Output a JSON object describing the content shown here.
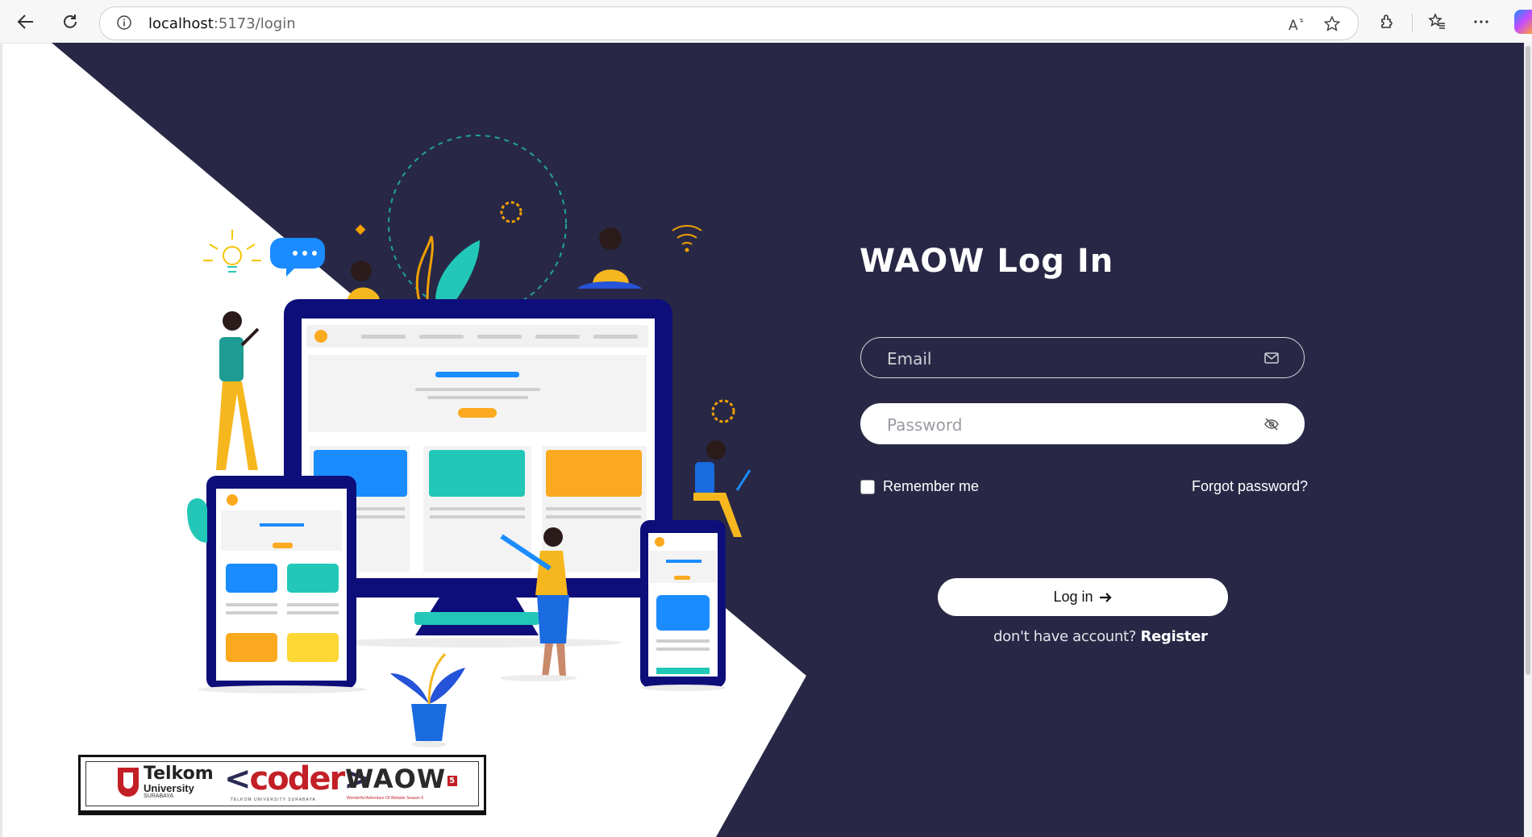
{
  "browser": {
    "url_host": "localhost",
    "url_path": ":5173/login",
    "icons": [
      "back-icon",
      "refresh-icon",
      "info-icon",
      "read-aloud-icon",
      "favorite-star-icon",
      "extensions-icon",
      "favorites-icon",
      "more-icon",
      "copilot-icon"
    ]
  },
  "login": {
    "title": "WAOW Log In",
    "email_placeholder": "Email",
    "password_placeholder": "Password",
    "remember_label": "Remember me",
    "forgot_label": "Forgot password?",
    "button_label": "Log in",
    "no_account_text": "don't have account?",
    "register_label": "Register"
  },
  "logos": {
    "telkom_line1": "Telkom",
    "telkom_line2": "University",
    "telkom_line3": "SURABAYA",
    "coder_open": "<",
    "coder_word": "coder",
    "coder_close": ">",
    "coder_sub": "TELKOM UNIVERSITY SURABAYA",
    "waow": "WAOW",
    "waow_num": "5",
    "waow_sub": "Wonderful Adventure Of Website Season 5"
  },
  "colors": {
    "panel": "#282846",
    "accent_blue": "#1a8cff",
    "accent_teal": "#22c7b8",
    "accent_yellow": "#fbaa1f",
    "monitor_navy": "#0e0e7a"
  }
}
